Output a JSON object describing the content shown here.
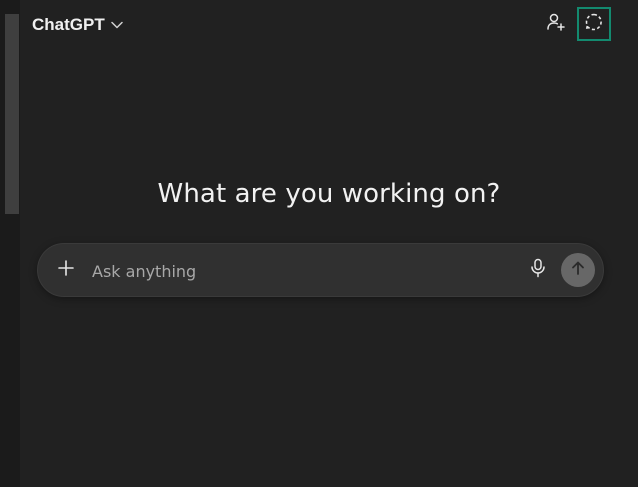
{
  "header": {
    "model_name": "ChatGPT",
    "model_chevron_icon": "chevron-down-icon",
    "share_icon": "add-person-icon",
    "temporary_chat_icon": "dashed-bubble-icon"
  },
  "main": {
    "headline": "What are you working on?"
  },
  "composer": {
    "placeholder": "Ask anything",
    "value": "",
    "attach_icon": "plus-icon",
    "voice_icon": "microphone-icon",
    "send_icon": "arrow-up-icon"
  },
  "colors": {
    "background": "#212121",
    "composer": "#303030",
    "highlight": "#138a6f",
    "send_button": "#676767"
  }
}
